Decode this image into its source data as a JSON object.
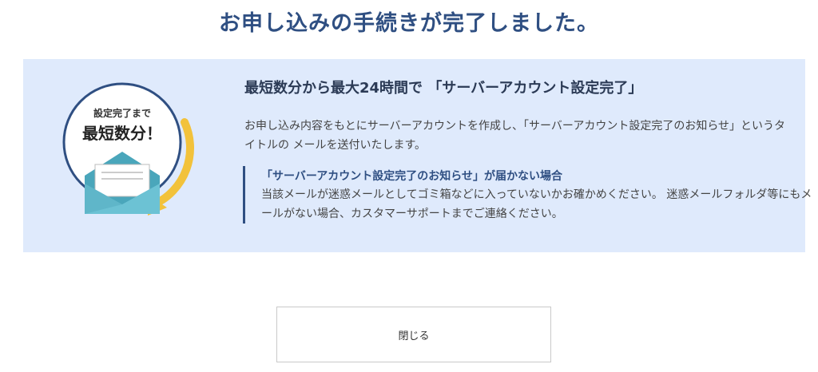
{
  "page": {
    "title": "お申し込みの手続きが完了しました。"
  },
  "badge": {
    "line1": "設定完了まで",
    "line2": "最短数分！"
  },
  "panel": {
    "heading": "最短数分から最大24時間で 「サーバーアカウント設定完了」",
    "body": "お申し込み内容をもとにサーバーアカウントを作成し、「サーバーアカウント設定完了のお知らせ」というタイトルの メールを送付いたします。",
    "notice_title": "「サーバーアカウント設定完了のお知らせ」が届かない場合",
    "notice_text": "当該メールが迷惑メールとしてゴミ箱などに入っていないかお確かめください。 迷惑メールフォルダ等にもメールがない場合、カスタマーサポートまでご連絡ください。"
  },
  "actions": {
    "close_label": "閉じる"
  },
  "colors": {
    "title": "#2f4f82",
    "panel_bg": "#dfeafc",
    "badge_arc": "#f2c23b",
    "envelope": "#5fb6c9"
  }
}
